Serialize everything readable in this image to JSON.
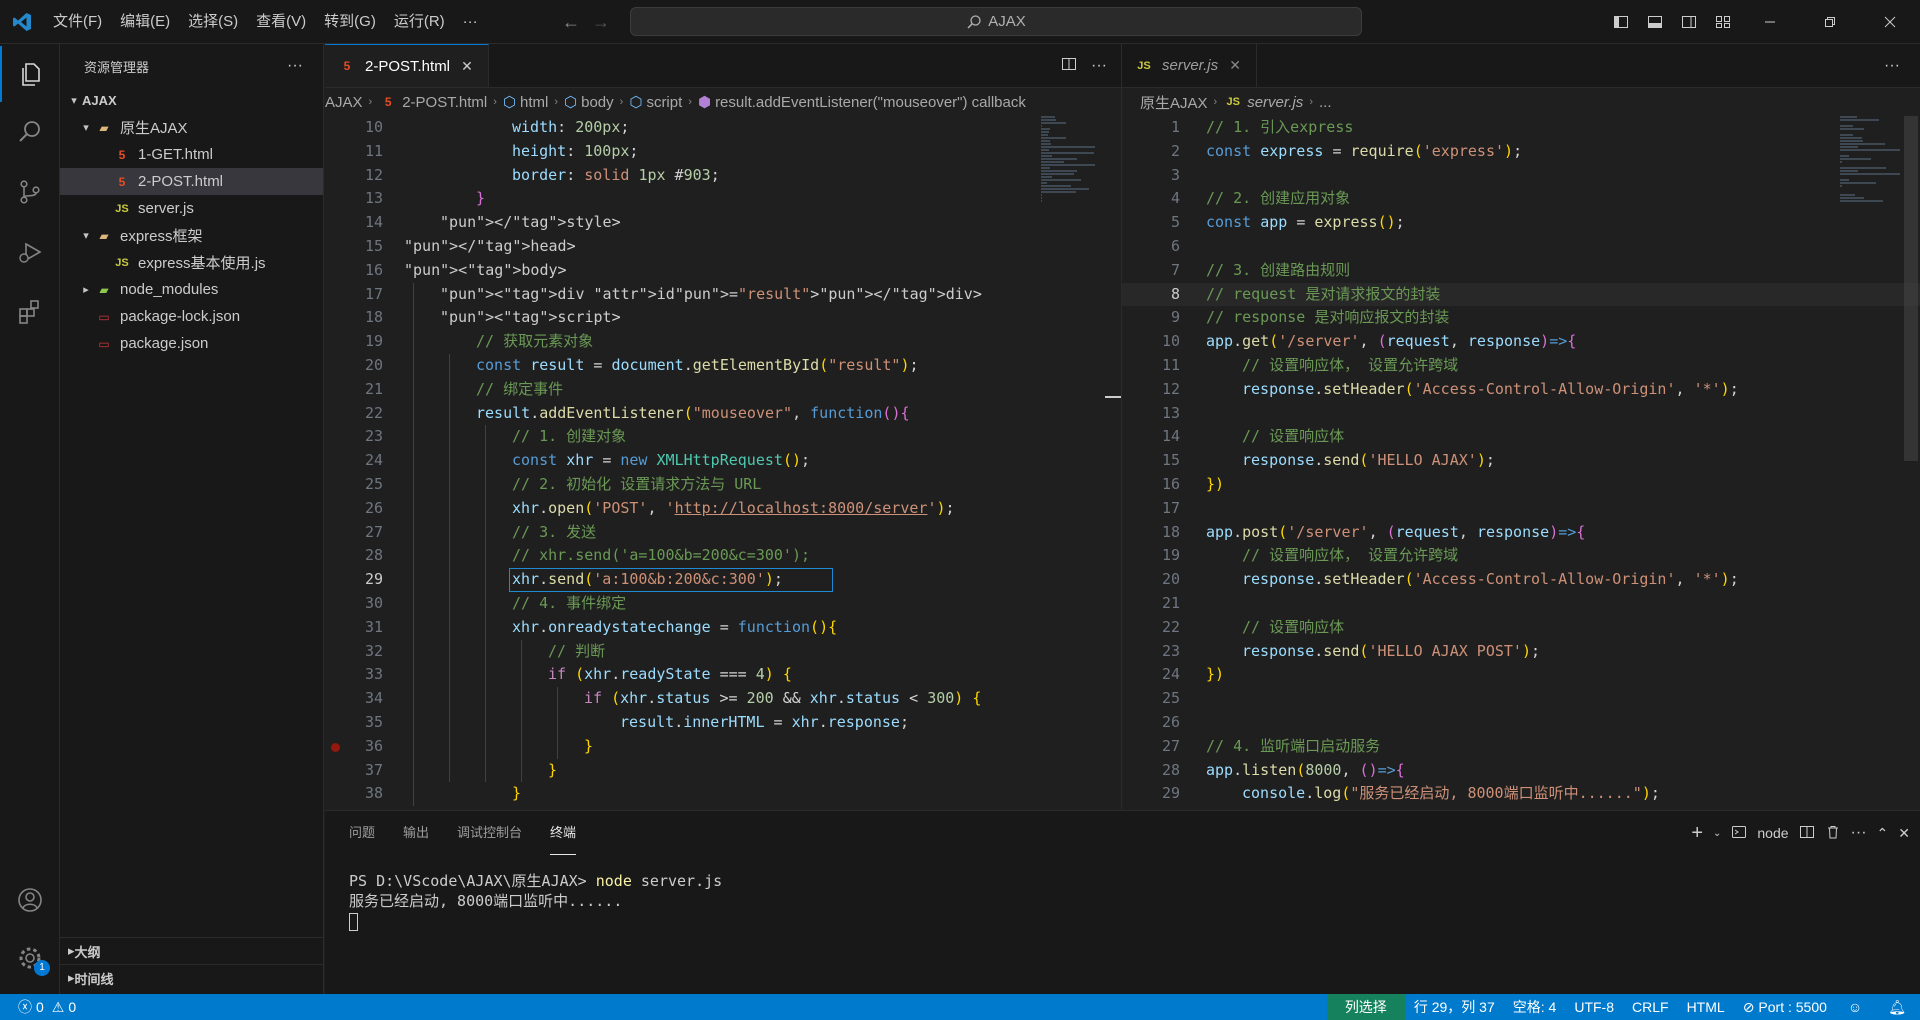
{
  "menu": [
    "文件(F)",
    "编辑(E)",
    "选择(S)",
    "查看(V)",
    "转到(G)",
    "运行(R)",
    "···"
  ],
  "search": {
    "text": "AJAX"
  },
  "sidebar": {
    "title": "资源管理器",
    "root": "AJAX",
    "items": [
      {
        "label": "原生AJAX",
        "type": "folder"
      },
      {
        "label": "1-GET.html",
        "type": "html"
      },
      {
        "label": "2-POST.html",
        "type": "html"
      },
      {
        "label": "server.js",
        "type": "js"
      },
      {
        "label": "express框架",
        "type": "folder"
      },
      {
        "label": "express基本使用.js",
        "type": "js"
      },
      {
        "label": "node_modules",
        "type": "node"
      },
      {
        "label": "package-lock.json",
        "type": "json"
      },
      {
        "label": "package.json",
        "type": "json"
      }
    ],
    "outline": "大纲",
    "timeline": "时间线"
  },
  "left_editor": {
    "tab": "2-POST.html",
    "breadcrumb": [
      "AJAX",
      "2-POST.html",
      "html",
      "body",
      "script",
      "result.addEventListener(\"mouseover\") callback"
    ],
    "lines": [
      {
        "n": "10",
        "c": "width: 200px;"
      },
      {
        "n": "11",
        "c": "height: 100px;"
      },
      {
        "n": "12",
        "c": "border: solid 1px #903;"
      },
      {
        "n": "13",
        "c": "}"
      },
      {
        "n": "14",
        "c": "</style>"
      },
      {
        "n": "15",
        "c": "</head>"
      },
      {
        "n": "16",
        "c": "<body>"
      },
      {
        "n": "17",
        "c": "<div id=\"result\"></div>"
      },
      {
        "n": "18",
        "c": "<script>"
      },
      {
        "n": "19",
        "c": "// 获取元素对象"
      },
      {
        "n": "20",
        "c": "const result = document.getElementById(\"result\");"
      },
      {
        "n": "21",
        "c": "// 绑定事件"
      },
      {
        "n": "22",
        "c": "result.addEventListener(\"mouseover\", function(){"
      },
      {
        "n": "23",
        "c": "// 1. 创建对象"
      },
      {
        "n": "24",
        "c": "const xhr = new XMLHttpRequest();"
      },
      {
        "n": "25",
        "c": "// 2. 初始化 设置请求方法与 URL"
      },
      {
        "n": "26",
        "c": "xhr.open('POST', 'http://localhost:8000/server');"
      },
      {
        "n": "27",
        "c": "// 3. 发送"
      },
      {
        "n": "28",
        "c": "// xhr.send('a=100&b=200&c=300');"
      },
      {
        "n": "29",
        "c": "xhr.send('a:100&b:200&c:300');"
      },
      {
        "n": "30",
        "c": "// 4. 事件绑定"
      },
      {
        "n": "31",
        "c": "xhr.onreadystatechange = function(){"
      },
      {
        "n": "32",
        "c": "// 判断"
      },
      {
        "n": "33",
        "c": "if (xhr.readyState === 4) {"
      },
      {
        "n": "34",
        "c": "if (xhr.status >= 200 && xhr.status < 300) {"
      },
      {
        "n": "35",
        "c": "result.innerHTML = xhr.response;"
      },
      {
        "n": "36",
        "c": "}"
      },
      {
        "n": "37",
        "c": "}"
      },
      {
        "n": "38",
        "c": "}"
      }
    ]
  },
  "right_editor": {
    "tab": "server.js",
    "breadcrumb": [
      "原生AJAX",
      "server.js",
      "..."
    ],
    "lines": [
      {
        "n": "1",
        "c": "// 1. 引入express"
      },
      {
        "n": "2",
        "c": "const express = require('express');"
      },
      {
        "n": "3",
        "c": ""
      },
      {
        "n": "4",
        "c": "// 2. 创建应用对象"
      },
      {
        "n": "5",
        "c": "const app = express();"
      },
      {
        "n": "6",
        "c": ""
      },
      {
        "n": "7",
        "c": "// 3. 创建路由规则"
      },
      {
        "n": "8",
        "c": "// request 是对请求报文的封装"
      },
      {
        "n": "9",
        "c": "// response 是对响应报文的封装"
      },
      {
        "n": "10",
        "c": "app.get('/server', (request, response)=>{"
      },
      {
        "n": "11",
        "c": "// 设置响应体， 设置允许跨域"
      },
      {
        "n": "12",
        "c": "response.setHeader('Access-Control-Allow-Origin', '*');"
      },
      {
        "n": "13",
        "c": ""
      },
      {
        "n": "14",
        "c": "// 设置响应体"
      },
      {
        "n": "15",
        "c": "response.send('HELLO AJAX');"
      },
      {
        "n": "16",
        "c": "})"
      },
      {
        "n": "17",
        "c": ""
      },
      {
        "n": "18",
        "c": "app.post('/server', (request, response)=>{"
      },
      {
        "n": "19",
        "c": "// 设置响应体， 设置允许跨域"
      },
      {
        "n": "20",
        "c": "response.setHeader('Access-Control-Allow-Origin', '*');"
      },
      {
        "n": "21",
        "c": ""
      },
      {
        "n": "22",
        "c": "// 设置响应体"
      },
      {
        "n": "23",
        "c": "response.send('HELLO AJAX POST');"
      },
      {
        "n": "24",
        "c": "})"
      },
      {
        "n": "25",
        "c": ""
      },
      {
        "n": "26",
        "c": ""
      },
      {
        "n": "27",
        "c": "// 4. 监听端口启动服务"
      },
      {
        "n": "28",
        "c": "app.listen(8000, ()=>{"
      },
      {
        "n": "29",
        "c": "console.log(\"服务已经启动, 8000端口监听中......\");"
      }
    ]
  },
  "panel": {
    "tabs": [
      "问题",
      "输出",
      "调试控制台",
      "终端"
    ],
    "active_tab": "终端",
    "terminal_shell": "node",
    "terminal_lines": [
      "PS D:\\VScode\\AJAX\\原生AJAX> node server.js",
      "服务已经启动, 8000端口监听中......"
    ]
  },
  "status": {
    "errors": "0",
    "warnings": "0",
    "mode": "列选择",
    "position": "行 29，列 37",
    "indent": "空格: 4",
    "encoding": "UTF-8",
    "eol": "CRLF",
    "language": "HTML",
    "port": "Port : 5500"
  },
  "colors": {
    "accent": "#007acc",
    "error_dot": "#e51400",
    "color_swatch": "#990033"
  }
}
